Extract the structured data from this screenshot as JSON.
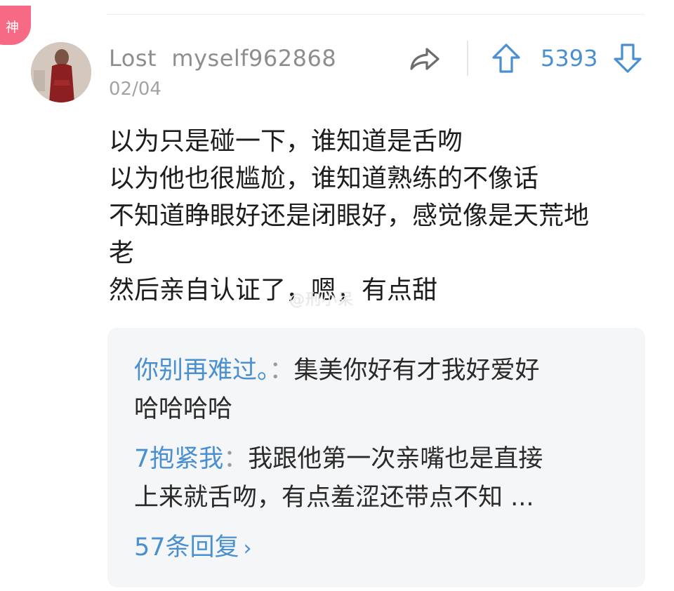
{
  "badge": {
    "label": "神"
  },
  "comment": {
    "username": "Lost  myself962868",
    "date": "02/04",
    "vote_count": "5393",
    "lines": [
      "以为只是碰一下，谁知道是舌吻",
      "以为他也很尴尬，谁知道熟练的不像话",
      "不知道睁眼好还是闭眼好，感觉像是天荒地",
      "老",
      "然后亲自认证了，嗯，有点甜"
    ]
  },
  "watermark": {
    "text": "@刑小呆"
  },
  "replies": [
    {
      "name": "你别再难过。",
      "separator": "：",
      "line1": "集美你好有才我好爱好",
      "line2": "哈哈哈哈"
    },
    {
      "name": "7抱紧我",
      "separator": "：",
      "line1": "我跟他第一次亲嘴也是直接",
      "line2": "上来就舌吻，有点羞涩还带点不知 ..."
    }
  ],
  "more_replies": {
    "label": "57条回复",
    "chevron": "›"
  },
  "colors": {
    "accent_blue": "#4a8fd0",
    "badge_pink": "#f66a86",
    "reply_bg": "#f5f6f8",
    "meta_gray": "#8e8e8e"
  },
  "icons": {
    "share": "share-arrow-icon",
    "upvote": "arrow-up-icon",
    "downvote": "arrow-down-icon"
  }
}
